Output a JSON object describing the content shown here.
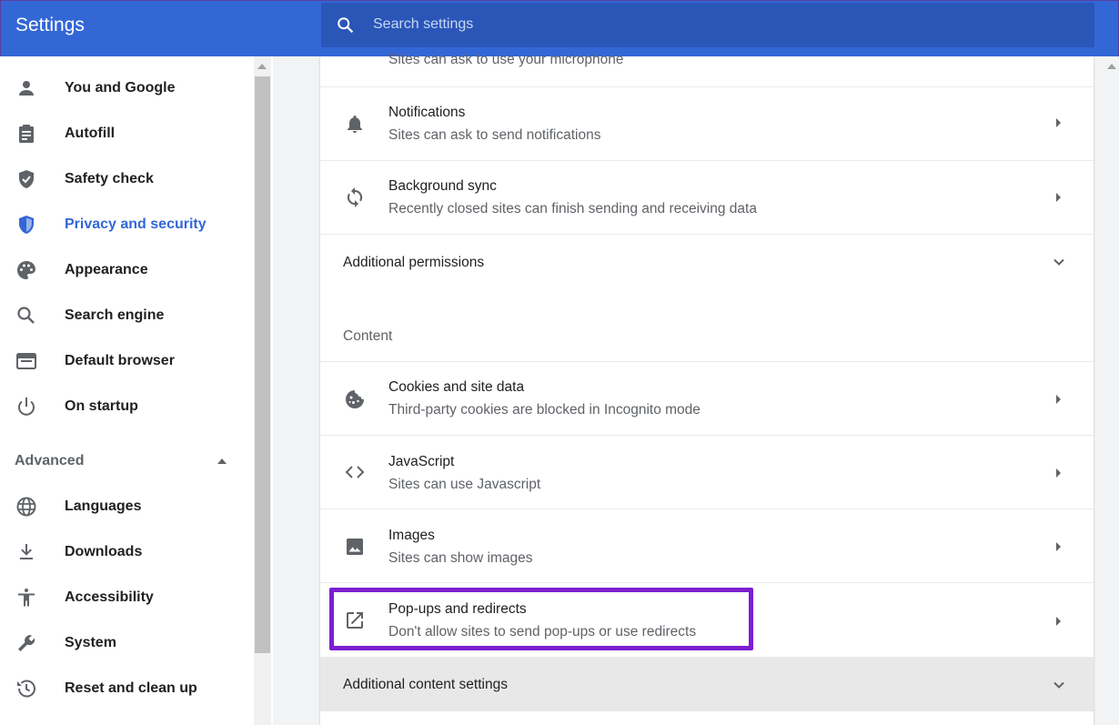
{
  "header": {
    "title": "Settings",
    "search_placeholder": "Search settings"
  },
  "sidebar": {
    "items": [
      {
        "label": "You and Google",
        "icon": "person-icon"
      },
      {
        "label": "Autofill",
        "icon": "clipboard-icon"
      },
      {
        "label": "Safety check",
        "icon": "shield-icon"
      },
      {
        "label": "Privacy and security",
        "icon": "shield-blue-icon",
        "active": true
      },
      {
        "label": "Appearance",
        "icon": "palette-icon"
      },
      {
        "label": "Search engine",
        "icon": "search-icon"
      },
      {
        "label": "Default browser",
        "icon": "browser-icon"
      },
      {
        "label": "On startup",
        "icon": "power-icon"
      }
    ],
    "advanced_label": "Advanced",
    "advanced_items": [
      {
        "label": "Languages",
        "icon": "globe-icon"
      },
      {
        "label": "Downloads",
        "icon": "download-icon"
      },
      {
        "label": "Accessibility",
        "icon": "accessibility-icon"
      },
      {
        "label": "System",
        "icon": "wrench-icon"
      },
      {
        "label": "Reset and clean up",
        "icon": "history-icon"
      }
    ]
  },
  "main": {
    "partial_row_subtitle": "Sites can ask to use your microphone",
    "permissions": [
      {
        "title": "Notifications",
        "subtitle": "Sites can ask to send notifications",
        "icon": "bell-icon"
      },
      {
        "title": "Background sync",
        "subtitle": "Recently closed sites can finish sending and receiving data",
        "icon": "sync-icon"
      }
    ],
    "additional_permissions_label": "Additional permissions",
    "content_section_title": "Content",
    "content_items": [
      {
        "title": "Cookies and site data",
        "subtitle": "Third-party cookies are blocked in Incognito mode",
        "icon": "cookie-icon"
      },
      {
        "title": "JavaScript",
        "subtitle": "Sites can use Javascript",
        "icon": "code-icon"
      },
      {
        "title": "Images",
        "subtitle": "Sites can show images",
        "icon": "image-icon"
      },
      {
        "title": "Pop-ups and redirects",
        "subtitle": "Don't allow sites to send pop-ups or use redirects",
        "icon": "open-in-new-icon",
        "highlighted": true
      }
    ],
    "additional_content_label": "Additional content settings"
  },
  "colors": {
    "header_bg": "#3367d6",
    "active": "#3367d6",
    "highlight": "#7b1fd0"
  }
}
